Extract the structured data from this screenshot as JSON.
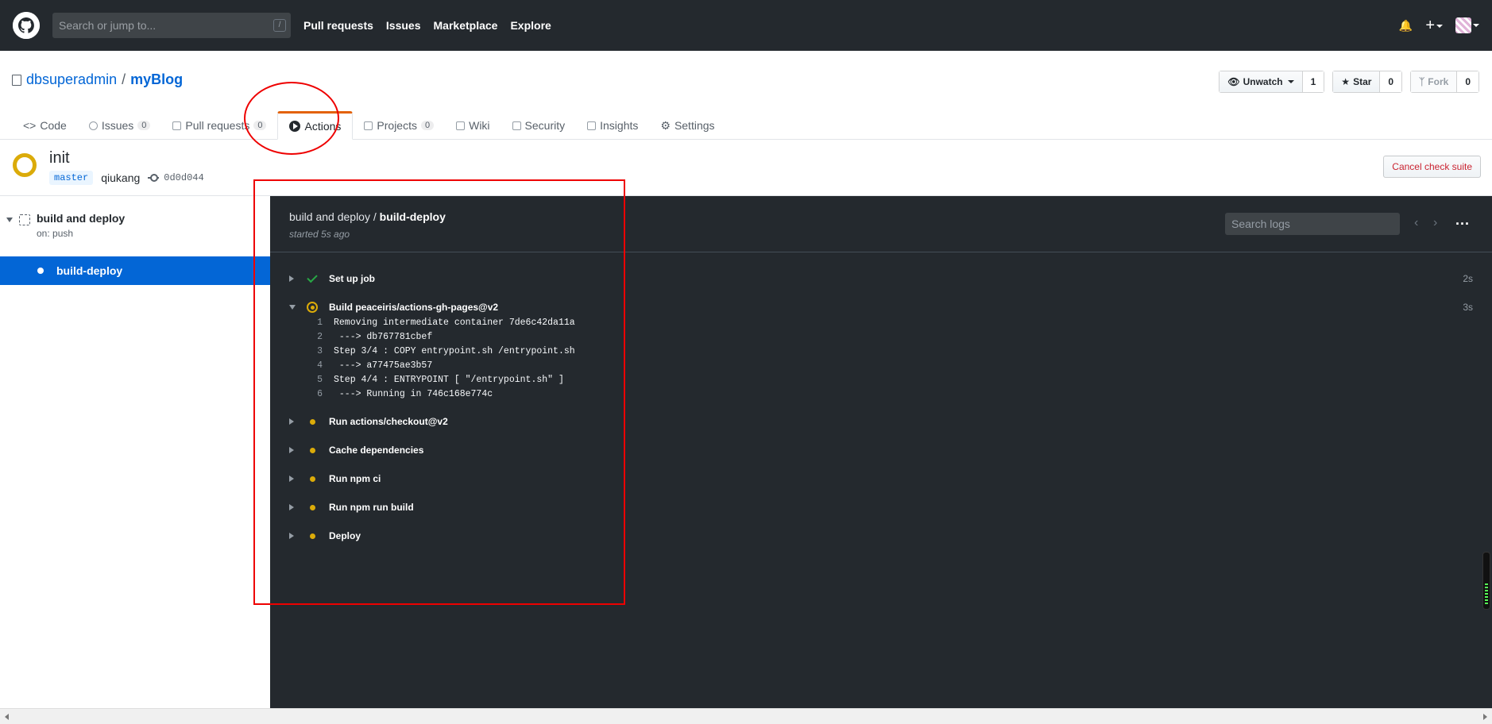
{
  "header": {
    "search_placeholder": "Search or jump to...",
    "search_shortcut": "/",
    "nav": [
      "Pull requests",
      "Issues",
      "Marketplace",
      "Explore"
    ]
  },
  "repo": {
    "owner": "dbsuperadmin",
    "separator": "/",
    "name": "myBlog",
    "unwatch_label": "Unwatch",
    "unwatch_count": "1",
    "star_label": "Star",
    "star_count": "0",
    "fork_label": "Fork",
    "fork_count": "0"
  },
  "tabs": {
    "code": "Code",
    "issues": "Issues",
    "issues_count": "0",
    "pulls": "Pull requests",
    "pulls_count": "0",
    "actions": "Actions",
    "projects": "Projects",
    "projects_count": "0",
    "wiki": "Wiki",
    "security": "Security",
    "insights": "Insights",
    "settings": "Settings"
  },
  "suite": {
    "title": "init",
    "branch": "master",
    "author": "qiukang",
    "sha": "0d0d044",
    "cancel_label": "Cancel check suite"
  },
  "sidebar": {
    "workflow_name": "build and deploy",
    "workflow_trigger": "on: push",
    "job_name": "build-deploy"
  },
  "log": {
    "workflow": "build and deploy",
    "job": "build-deploy",
    "title_sep": " / ",
    "started": "started 5s ago",
    "search_placeholder": "Search logs",
    "more": "...",
    "steps": [
      {
        "name": "Set up job",
        "duration": "2s",
        "status": "success"
      },
      {
        "name": "Build peaceiris/actions-gh-pages@v2",
        "duration": "3s",
        "status": "running"
      },
      {
        "name": "Run actions/checkout@v2",
        "duration": "",
        "status": "pending"
      },
      {
        "name": "Cache dependencies",
        "duration": "",
        "status": "pending"
      },
      {
        "name": "Run npm ci",
        "duration": "",
        "status": "pending"
      },
      {
        "name": "Run npm run build",
        "duration": "",
        "status": "pending"
      },
      {
        "name": "Deploy",
        "duration": "",
        "status": "pending"
      }
    ],
    "lines": [
      {
        "n": "1",
        "text": "Removing intermediate container 7de6c42da11a"
      },
      {
        "n": "2",
        "text": " ---> db767781cbef"
      },
      {
        "n": "3",
        "text": "Step 3/4 : COPY entrypoint.sh /entrypoint.sh"
      },
      {
        "n": "4",
        "text": " ---> a77475ae3b57"
      },
      {
        "n": "5",
        "text": "Step 4/4 : ENTRYPOINT [ \"/entrypoint.sh\" ]"
      },
      {
        "n": "6",
        "text": " ---> Running in 746c168e774c"
      }
    ]
  },
  "colors": {
    "header_bg": "#24292e",
    "link": "#0366d6",
    "pending": "#dbab09",
    "success": "#28a745",
    "annotation": "#ee0000"
  }
}
